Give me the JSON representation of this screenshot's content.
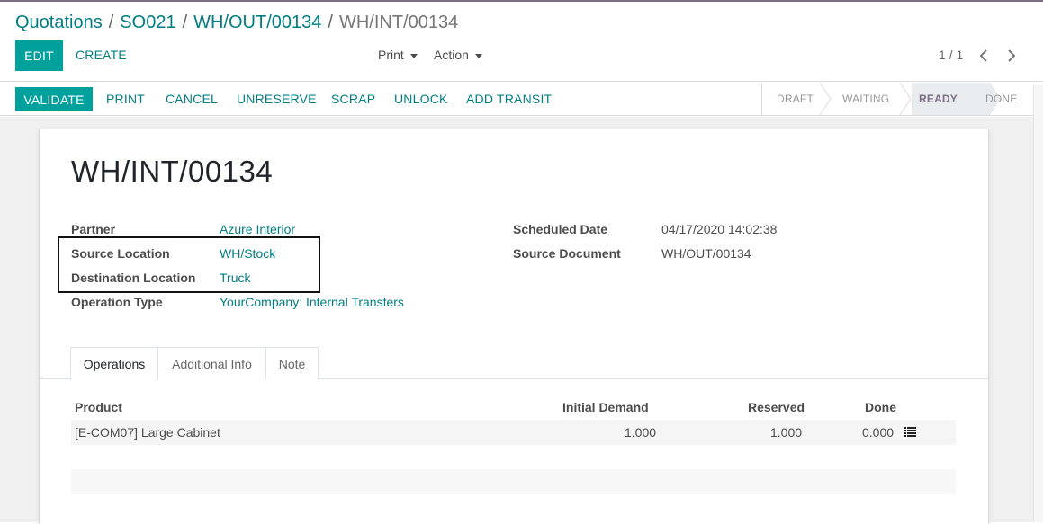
{
  "breadcrumb": {
    "items": [
      "Quotations",
      "SO021",
      "WH/OUT/00134"
    ],
    "separator": "/",
    "current": "WH/INT/00134"
  },
  "control_panel": {
    "edit_label": "EDIT",
    "create_label": "CREATE",
    "print_label": "Print",
    "action_label": "Action",
    "pager": "1 / 1"
  },
  "statusbar": {
    "buttons": [
      "VALIDATE",
      "PRINT",
      "CANCEL",
      "UNRESERVE",
      "SCRAP",
      "UNLOCK",
      "ADD TRANSIT"
    ],
    "stages": [
      "DRAFT",
      "WAITING",
      "READY",
      "DONE"
    ],
    "active_stage": "READY"
  },
  "record": {
    "name": "WH/INT/00134",
    "left_fields": [
      {
        "label": "Partner",
        "value": "Azure Interior"
      },
      {
        "label": "Source Location",
        "value": "WH/Stock"
      },
      {
        "label": "Destination Location",
        "value": "Truck"
      },
      {
        "label": "Operation Type",
        "value": "YourCompany: Internal Transfers"
      }
    ],
    "right_fields": [
      {
        "label": "Scheduled Date",
        "value": "04/17/2020 14:02:38"
      },
      {
        "label": "Source Document",
        "value": "WH/OUT/00134"
      }
    ]
  },
  "tabs": [
    "Operations",
    "Additional Info",
    "Note"
  ],
  "active_tab": "Operations",
  "operations_table": {
    "headers": [
      "Product",
      "Initial Demand",
      "Reserved",
      "Done"
    ],
    "rows": [
      {
        "product": "[E-COM07] Large Cabinet",
        "initial_demand": "1.000",
        "reserved": "1.000",
        "done": "0.000"
      }
    ]
  },
  "icons": {
    "pager_prev": "chevron-left-icon",
    "pager_next": "chevron-right-icon",
    "detailed_operations": "list-icon"
  },
  "colors": {
    "primary": "#00a09d",
    "link": "#017e84",
    "active_stage": "#7c6d86",
    "highlight_box": "#111111"
  }
}
